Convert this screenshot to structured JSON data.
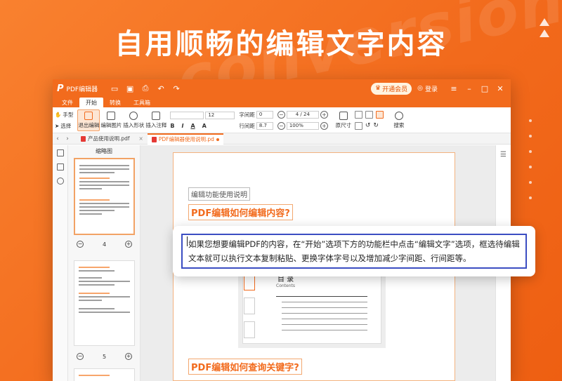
{
  "headline": "自用顺畅的编辑文字内容",
  "watermark_text": "conversion",
  "titlebar": {
    "app_logo": "P",
    "app_name": "PDF编辑器",
    "vip_label": "开通会员",
    "login_label": "登录"
  },
  "menu": {
    "tabs": [
      {
        "label": "文件",
        "active": false
      },
      {
        "label": "开始",
        "active": true
      },
      {
        "label": "转换",
        "active": false
      },
      {
        "label": "工具箱",
        "active": false
      }
    ]
  },
  "ribbon": {
    "hand_tool": "手型",
    "select_tool": "选择",
    "exit_edit": "退出编辑",
    "edit_image": "编辑图片",
    "insert_shape": "插入形状",
    "insert_note": "插入注释",
    "font_name": "",
    "font_size": "12",
    "char_spacing_label": "字间距",
    "char_spacing_value": "0",
    "line_spacing_label": "行间距",
    "line_spacing_value": "8.7",
    "page_indicator": "4 / 24",
    "zoom_value": "100%",
    "actual_size": "原尺寸",
    "search": "搜索"
  },
  "tabs": {
    "items": [
      {
        "label": "产品使用说明.pdf",
        "active": false
      },
      {
        "label": "PDF编辑器使用说明.pd",
        "active": true
      }
    ]
  },
  "thumbnails": {
    "title": "缩略图",
    "page_a": "4",
    "page_b": "5"
  },
  "document": {
    "section_label": "编辑功能使用说明",
    "heading_1": "PDF编辑如何编辑内容?",
    "heading_2": "PDF编辑如何查询关键字?",
    "toc_title": "目 录",
    "toc_subtitle": "Contents"
  },
  "popup": {
    "text": "如果您想要编辑PDF的内容，在“开始”选项下方的功能栏中点击“编辑文字”选项，框选待编辑文本就可以执行文本复制粘贴、更换字体字号以及增加减少字间距、行间距等。"
  },
  "colors": {
    "brand_orange": "#f26b1d",
    "highlight_blue": "#3b4dc2"
  }
}
